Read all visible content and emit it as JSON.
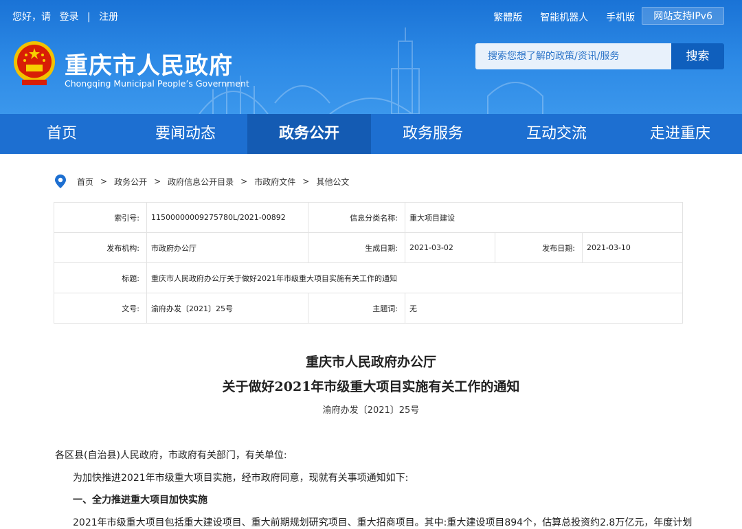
{
  "topbar": {
    "greeting": "您好，请",
    "login": "登录",
    "sep": "|",
    "register": "注册",
    "links": [
      "繁體版",
      "智能机器人",
      "手机版"
    ],
    "ipv6": "网站支持IPv6"
  },
  "site": {
    "title": "重庆市人民政府",
    "subtitle": "Chongqing Municipal People’s Government"
  },
  "search": {
    "placeholder": "搜索您想了解的政策/资讯/服务",
    "button": "搜索"
  },
  "nav": [
    {
      "label": "首页"
    },
    {
      "label": "要闻动态"
    },
    {
      "label": "政务公开",
      "active": true
    },
    {
      "label": "政务服务"
    },
    {
      "label": "互动交流"
    },
    {
      "label": "走进重庆"
    }
  ],
  "breadcrumb": [
    "首页",
    "政务公开",
    "政府信息公开目录",
    "市政府文件",
    "其他公文"
  ],
  "breadcrumb_sep": ">",
  "info": {
    "index_label": "索引号:",
    "index_value": "11500000009275780L/2021-00892",
    "category_label": "信息分类名称:",
    "category_value": "重大项目建设",
    "publisher_label": "发布机构:",
    "publisher_value": "市政府办公厅",
    "created_label": "生成日期:",
    "created_value": "2021-03-02",
    "published_label": "发布日期:",
    "published_value": "2021-03-10",
    "title_label": "标题:",
    "title_value": "重庆市人民政府办公厅关于做好2021年市级重大项目实施有关工作的通知",
    "docno_label": "文号:",
    "docno_value": "渝府办发〔2021〕25号",
    "subject_label": "主题词:",
    "subject_value": "无"
  },
  "document": {
    "title_line1": "重庆市人民政府办公厅",
    "title_line2": "关于做好2021年市级重大项目实施有关工作的通知",
    "number": "渝府办发〔2021〕25号",
    "salutation": "各区县(自治县)人民政府，市政府有关部门，有关单位:",
    "para1": "为加快推进2021年市级重大项目实施，经市政府同意，现就有关事项通知如下:",
    "heading1": "一、全力推进重大项目加快实施",
    "para2": "2021年市级重大项目包括重大建设项目、重大前期规划研究项目、重大招商项目。其中:重大建设项目894个，估算总投资约2.8万亿元，年度计划"
  }
}
